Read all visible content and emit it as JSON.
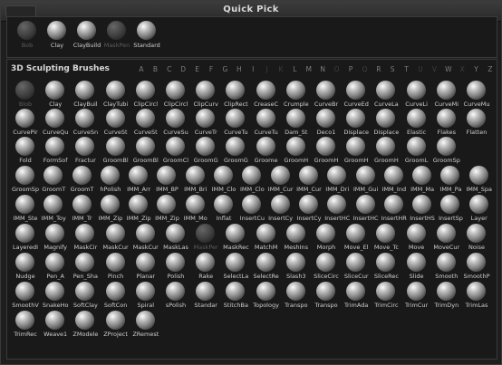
{
  "titlebar": {
    "title": "Quick Pick"
  },
  "quick_pick": [
    {
      "label": "Bob",
      "dim": true
    },
    {
      "label": "Clay",
      "dim": false
    },
    {
      "label": "ClayBuild",
      "dim": false
    },
    {
      "label": "MaskPen",
      "dim": true
    },
    {
      "label": "Standard",
      "dim": false
    }
  ],
  "brushes_panel": {
    "title": "3D Sculpting Brushes",
    "alphabet": [
      {
        "letter": "A",
        "dim": false
      },
      {
        "letter": "B",
        "dim": false
      },
      {
        "letter": "C",
        "dim": false
      },
      {
        "letter": "D",
        "dim": false
      },
      {
        "letter": "E",
        "dim": false
      },
      {
        "letter": "F",
        "dim": false
      },
      {
        "letter": "G",
        "dim": false
      },
      {
        "letter": "H",
        "dim": false
      },
      {
        "letter": "I",
        "dim": false
      },
      {
        "letter": "J",
        "dim": true
      },
      {
        "letter": "K",
        "dim": true
      },
      {
        "letter": "L",
        "dim": false
      },
      {
        "letter": "M",
        "dim": false
      },
      {
        "letter": "N",
        "dim": false
      },
      {
        "letter": "O",
        "dim": true
      },
      {
        "letter": "P",
        "dim": false
      },
      {
        "letter": "Q",
        "dim": true
      },
      {
        "letter": "R",
        "dim": false
      },
      {
        "letter": "S",
        "dim": false
      },
      {
        "letter": "T",
        "dim": false
      },
      {
        "letter": "U",
        "dim": true
      },
      {
        "letter": "V",
        "dim": true
      },
      {
        "letter": "W",
        "dim": false
      },
      {
        "letter": "X",
        "dim": true
      },
      {
        "letter": "Y",
        "dim": false
      },
      {
        "letter": "Z",
        "dim": false
      }
    ],
    "brushes": [
      [
        "Blob",
        "Clay",
        "ClayBuil",
        "ClayTubi",
        "ClipCircl",
        "ClipCircl",
        "ClipCurv",
        "ClipRect",
        "CreaseC",
        "Crumple",
        "CurveBr",
        "CurveEd",
        "CurveLa",
        "CurveLi",
        "CurveMi",
        "CurveMu"
      ],
      [
        "CurvePir",
        "CurveQu",
        "CurveSn",
        "CurveSt",
        "CurveSt",
        "CurveSu",
        "CurveTr",
        "CurveTu",
        "CurveTu",
        "Dam_St",
        "Deco1",
        "Displace",
        "Displace",
        "Elastic",
        "Flakes",
        "Flatten"
      ],
      [
        "Fold",
        "FormSof",
        "Fractur",
        "GroomBl",
        "GroomBl",
        "GroomCl",
        "GroomG",
        "GroomG",
        "Groome",
        "GroomH",
        "GroomH",
        "GroomH",
        "GroomH",
        "GroomL",
        "GroomSp"
      ],
      [
        "GroomSp",
        "GroomT",
        "GroomT",
        "hPolish",
        "IMM_Arr",
        "IMM_BP",
        "IMM_Bri",
        "IMM_Clo",
        "IMM_Clo",
        "IMM_Cur",
        "IMM_Cur",
        "IMM_Dri",
        "IMM_Gui",
        "IMM_Ind",
        "IMM_Ma",
        "IMM_Pa",
        "IMM_Spa"
      ],
      [
        "IMM_Ste",
        "IMM_Toy",
        "IMM_Tr",
        "IMM_Zip",
        "IMM_Zip",
        "IMM_Zip",
        "IMM_Mo",
        "Inflat",
        "InsertCu",
        "InsertCy",
        "InsertCy",
        "InsertHC",
        "InsertHC",
        "InsertHR",
        "InsertHS",
        "InsertSp",
        "Layer"
      ],
      [
        "LayeredI",
        "Magnify",
        "MaskCir",
        "MaskCur",
        "MaskCur",
        "MaskLas",
        "MaskPer",
        "MaskRec",
        "MatchM",
        "MeshIns",
        "Morph",
        "Move_El",
        "Move_Tc",
        "Move",
        "MoveCur",
        "Noise"
      ],
      [
        "Nudge",
        "Pen_A",
        "Pen_Sha",
        "Pinch",
        "Planar",
        "Polish",
        "Rake",
        "SelectLa",
        "SelectRe",
        "Slash3",
        "SliceCirc",
        "SliceCur",
        "SliceRec",
        "Slide",
        "Smooth",
        "SmoothP"
      ],
      [
        "SmoothV",
        "SnakeHo",
        "SoftClay",
        "SoftCon",
        "Spiral",
        "sPolish",
        "Standar",
        "StitchBa",
        "Topology",
        "Transpo",
        "Transpo",
        "TrimAda",
        "TrimCirc",
        "TrimCur",
        "TrimDyn",
        "TrimLas"
      ],
      [
        "TrimRec",
        "Weave1",
        "ZModele",
        "ZProject",
        "ZRemest"
      ]
    ],
    "dim_labels": [
      "Blob",
      "MaskPer"
    ]
  }
}
